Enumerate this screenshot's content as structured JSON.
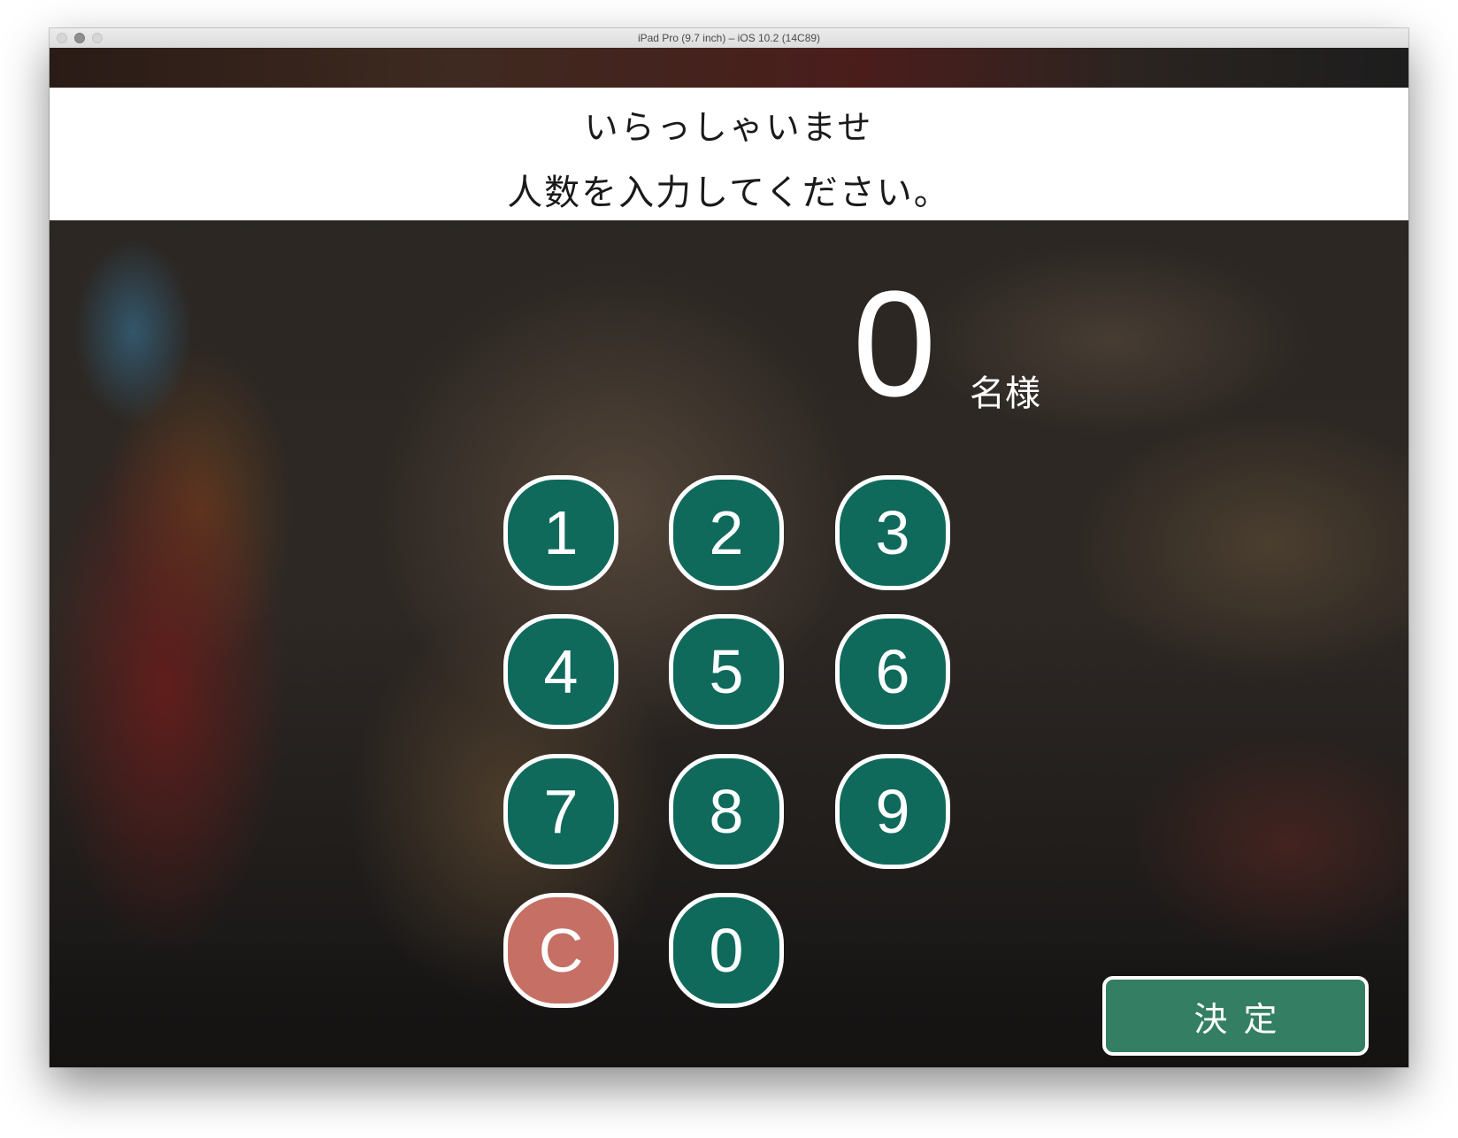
{
  "window": {
    "title": "iPad Pro (9.7 inch) – iOS 10.2 (14C89)"
  },
  "header": {
    "line1": "いらっしゃいませ",
    "line2": "人数を入力してください。"
  },
  "display": {
    "count": "0",
    "unit": "名様"
  },
  "keypad": {
    "k1": "1",
    "k2": "2",
    "k3": "3",
    "k4": "4",
    "k5": "5",
    "k6": "6",
    "k7": "7",
    "k8": "8",
    "k9": "9",
    "clear": "C",
    "k0": "0"
  },
  "confirm_label": "決定",
  "colors": {
    "key_green": "#0f6a5c",
    "clear_red": "#c67065",
    "confirm_green": "#347f63",
    "key_border": "#ffffff"
  }
}
